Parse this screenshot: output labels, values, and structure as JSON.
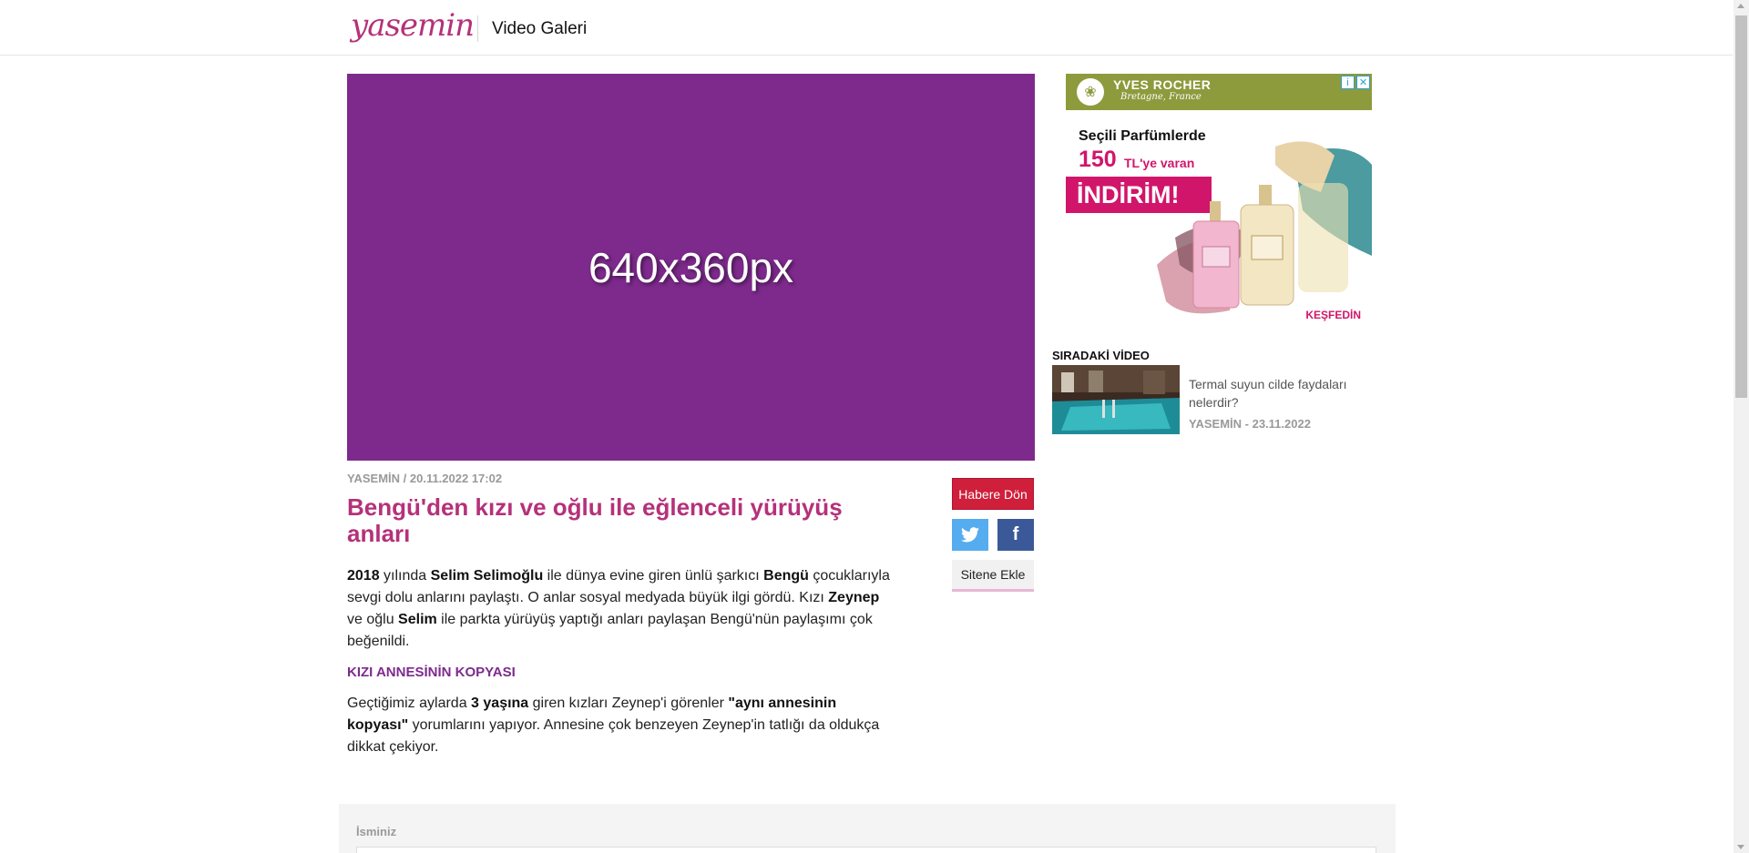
{
  "header": {
    "logo": "yasemin",
    "section": "Video Galeri"
  },
  "video": {
    "placeholder": "640x360px",
    "color": "#7e2a8d"
  },
  "article": {
    "meta": "YASEMİN / 20.11.2022 17:02",
    "title": "Bengü'den kızı ve oğlu ile eğlenceli yürüyüş anları",
    "p1": [
      {
        "b": "2018"
      },
      {
        "t": " yılında "
      },
      {
        "b": "Selim Selimoğlu"
      },
      {
        "t": " ile dünya evine giren ünlü şarkıcı "
      },
      {
        "b": "Bengü"
      },
      {
        "t": " çocuklarıyla sevgi dolu anlarını paylaştı. O anlar sosyal medyada büyük ilgi gördü. Kızı "
      },
      {
        "b": "Zeynep"
      },
      {
        "t": " ve oğlu "
      },
      {
        "b": "Selim"
      },
      {
        "t": " ile parkta yürüyüş yaptığı anları paylaşan Bengü'nün paylaşımı çok beğenildi."
      }
    ],
    "subhead": "KIZI ANNESİNİN KOPYASI",
    "p2": [
      {
        "t": "Geçtiğimiz aylarda "
      },
      {
        "b": "3 yaşına"
      },
      {
        "t": " giren kızları Zeynep'i görenler "
      },
      {
        "b": "\"aynı annesinin kopyası\""
      },
      {
        "t": " yorumlarını yapıyor. Annesine çok benzeyen Zeynep'in tatlığı da oldukça dikkat çekiyor."
      }
    ]
  },
  "actions": {
    "return_label": "Habere Dön",
    "twitter_icon": "twitter-icon",
    "facebook_icon": "facebook-icon",
    "facebook_glyph": "f",
    "embed_label": "Sitene Ekle"
  },
  "ad": {
    "brand": "YVES ROCHER",
    "brand_sub": "Bretagne, France",
    "headline": "Seçili Parfümlerde",
    "amount": "150",
    "amount_suffix": "TL'ye varan",
    "discount": "İNDİRİM!",
    "cta": "KEŞFEDİN",
    "info_icon": "i",
    "close_icon": "✕",
    "colors": {
      "green": "#8d9b3d",
      "pink": "#d1156b"
    }
  },
  "next_video": {
    "heading": "SIRADAKİ VİDEO",
    "title": "Termal suyun cilde faydaları nelerdir?",
    "meta": "YASEMİN - 23.11.2022"
  },
  "comments": {
    "name_label": "İsminiz"
  },
  "colors": {
    "brand": "#b5317a",
    "accent_purple": "#7e2a8d",
    "return_red": "#cf1f3a",
    "twitter": "#55acee",
    "facebook": "#3b5998"
  }
}
